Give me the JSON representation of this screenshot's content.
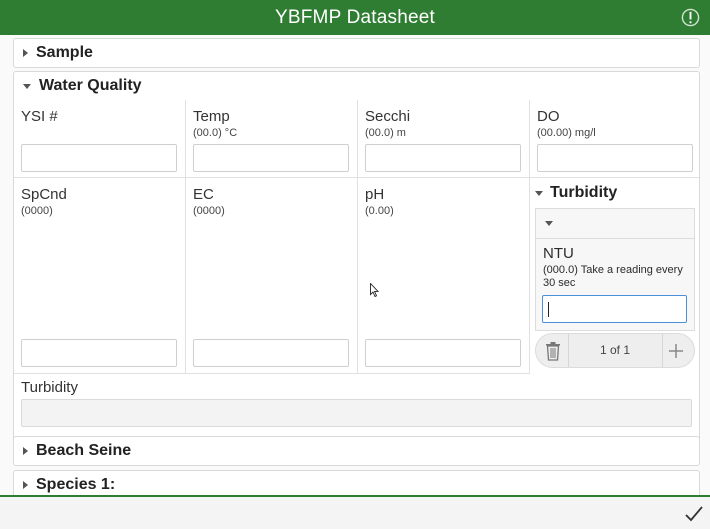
{
  "app": {
    "title": "YBFMP Datasheet",
    "accent_color": "#2f7d32",
    "alert_icon": "exclamation-icon"
  },
  "sections": {
    "sample": "Sample",
    "water_quality": "Water Quality",
    "beach_seine": "Beach Seine",
    "species": "Species 1:"
  },
  "fields": {
    "ysi": {
      "label": "YSI #",
      "hint": "",
      "value": ""
    },
    "temp": {
      "label": "Temp",
      "hint": "(00.0) °C",
      "value": ""
    },
    "secchi": {
      "label": "Secchi",
      "hint": "(00.0) m",
      "value": ""
    },
    "do": {
      "label": "DO",
      "hint": "(00.00) mg/l",
      "value": ""
    },
    "spcnd": {
      "label": "SpCnd",
      "hint": "(0000)",
      "value": ""
    },
    "ec": {
      "label": "EC",
      "hint": "(0000)",
      "value": ""
    },
    "ph": {
      "label": "pH",
      "hint": "(0.00)",
      "value": ""
    },
    "turbidity_notes": {
      "label": "Turbidity",
      "value": ""
    }
  },
  "turbidity_group": {
    "label": "Turbidity",
    "ntu": {
      "label": "NTU",
      "hint": "(000.0) Take a reading every 30 sec",
      "value": ""
    },
    "pager": {
      "text": "1 of 1"
    }
  },
  "footer": {
    "submit_icon": "checkmark-icon"
  }
}
